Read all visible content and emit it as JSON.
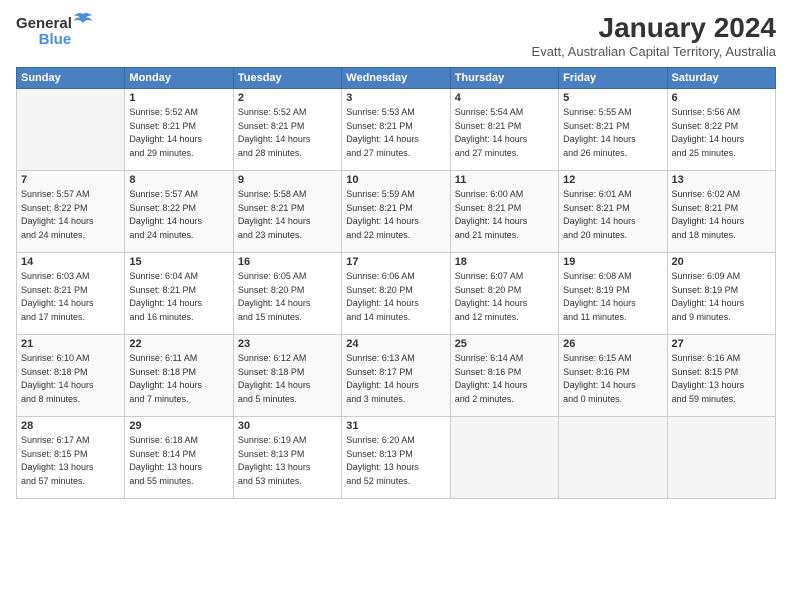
{
  "logo": {
    "general": "General",
    "blue": "Blue"
  },
  "title": "January 2024",
  "location": "Evatt, Australian Capital Territory, Australia",
  "days_header": [
    "Sunday",
    "Monday",
    "Tuesday",
    "Wednesday",
    "Thursday",
    "Friday",
    "Saturday"
  ],
  "weeks": [
    [
      {
        "day": "",
        "info": ""
      },
      {
        "day": "1",
        "info": "Sunrise: 5:52 AM\nSunset: 8:21 PM\nDaylight: 14 hours\nand 29 minutes."
      },
      {
        "day": "2",
        "info": "Sunrise: 5:52 AM\nSunset: 8:21 PM\nDaylight: 14 hours\nand 28 minutes."
      },
      {
        "day": "3",
        "info": "Sunrise: 5:53 AM\nSunset: 8:21 PM\nDaylight: 14 hours\nand 27 minutes."
      },
      {
        "day": "4",
        "info": "Sunrise: 5:54 AM\nSunset: 8:21 PM\nDaylight: 14 hours\nand 27 minutes."
      },
      {
        "day": "5",
        "info": "Sunrise: 5:55 AM\nSunset: 8:21 PM\nDaylight: 14 hours\nand 26 minutes."
      },
      {
        "day": "6",
        "info": "Sunrise: 5:56 AM\nSunset: 8:22 PM\nDaylight: 14 hours\nand 25 minutes."
      }
    ],
    [
      {
        "day": "7",
        "info": "Sunrise: 5:57 AM\nSunset: 8:22 PM\nDaylight: 14 hours\nand 24 minutes."
      },
      {
        "day": "8",
        "info": "Sunrise: 5:57 AM\nSunset: 8:22 PM\nDaylight: 14 hours\nand 24 minutes."
      },
      {
        "day": "9",
        "info": "Sunrise: 5:58 AM\nSunset: 8:21 PM\nDaylight: 14 hours\nand 23 minutes."
      },
      {
        "day": "10",
        "info": "Sunrise: 5:59 AM\nSunset: 8:21 PM\nDaylight: 14 hours\nand 22 minutes."
      },
      {
        "day": "11",
        "info": "Sunrise: 6:00 AM\nSunset: 8:21 PM\nDaylight: 14 hours\nand 21 minutes."
      },
      {
        "day": "12",
        "info": "Sunrise: 6:01 AM\nSunset: 8:21 PM\nDaylight: 14 hours\nand 20 minutes."
      },
      {
        "day": "13",
        "info": "Sunrise: 6:02 AM\nSunset: 8:21 PM\nDaylight: 14 hours\nand 18 minutes."
      }
    ],
    [
      {
        "day": "14",
        "info": "Sunrise: 6:03 AM\nSunset: 8:21 PM\nDaylight: 14 hours\nand 17 minutes."
      },
      {
        "day": "15",
        "info": "Sunrise: 6:04 AM\nSunset: 8:21 PM\nDaylight: 14 hours\nand 16 minutes."
      },
      {
        "day": "16",
        "info": "Sunrise: 6:05 AM\nSunset: 8:20 PM\nDaylight: 14 hours\nand 15 minutes."
      },
      {
        "day": "17",
        "info": "Sunrise: 6:06 AM\nSunset: 8:20 PM\nDaylight: 14 hours\nand 14 minutes."
      },
      {
        "day": "18",
        "info": "Sunrise: 6:07 AM\nSunset: 8:20 PM\nDaylight: 14 hours\nand 12 minutes."
      },
      {
        "day": "19",
        "info": "Sunrise: 6:08 AM\nSunset: 8:19 PM\nDaylight: 14 hours\nand 11 minutes."
      },
      {
        "day": "20",
        "info": "Sunrise: 6:09 AM\nSunset: 8:19 PM\nDaylight: 14 hours\nand 9 minutes."
      }
    ],
    [
      {
        "day": "21",
        "info": "Sunrise: 6:10 AM\nSunset: 8:18 PM\nDaylight: 14 hours\nand 8 minutes."
      },
      {
        "day": "22",
        "info": "Sunrise: 6:11 AM\nSunset: 8:18 PM\nDaylight: 14 hours\nand 7 minutes."
      },
      {
        "day": "23",
        "info": "Sunrise: 6:12 AM\nSunset: 8:18 PM\nDaylight: 14 hours\nand 5 minutes."
      },
      {
        "day": "24",
        "info": "Sunrise: 6:13 AM\nSunset: 8:17 PM\nDaylight: 14 hours\nand 3 minutes."
      },
      {
        "day": "25",
        "info": "Sunrise: 6:14 AM\nSunset: 8:16 PM\nDaylight: 14 hours\nand 2 minutes."
      },
      {
        "day": "26",
        "info": "Sunrise: 6:15 AM\nSunset: 8:16 PM\nDaylight: 14 hours\nand 0 minutes."
      },
      {
        "day": "27",
        "info": "Sunrise: 6:16 AM\nSunset: 8:15 PM\nDaylight: 13 hours\nand 59 minutes."
      }
    ],
    [
      {
        "day": "28",
        "info": "Sunrise: 6:17 AM\nSunset: 8:15 PM\nDaylight: 13 hours\nand 57 minutes."
      },
      {
        "day": "29",
        "info": "Sunrise: 6:18 AM\nSunset: 8:14 PM\nDaylight: 13 hours\nand 55 minutes."
      },
      {
        "day": "30",
        "info": "Sunrise: 6:19 AM\nSunset: 8:13 PM\nDaylight: 13 hours\nand 53 minutes."
      },
      {
        "day": "31",
        "info": "Sunrise: 6:20 AM\nSunset: 8:13 PM\nDaylight: 13 hours\nand 52 minutes."
      },
      {
        "day": "",
        "info": ""
      },
      {
        "day": "",
        "info": ""
      },
      {
        "day": "",
        "info": ""
      }
    ]
  ]
}
